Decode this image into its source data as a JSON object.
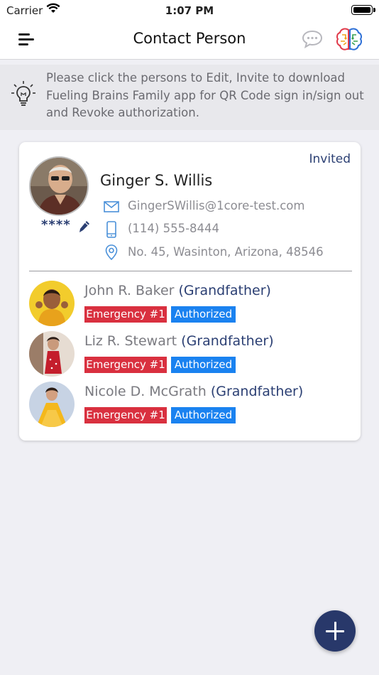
{
  "status_bar": {
    "carrier": "Carrier",
    "time": "1:07 PM"
  },
  "header": {
    "title": "Contact Person",
    "icons": [
      "menu-icon",
      "chat-icon",
      "brain-logo-icon"
    ]
  },
  "info_banner": {
    "icon": "lightbulb-icon",
    "text": "Please click the persons to Edit, Invite to download Fueling Brains Family app for QR Code sign in/sign out and Revoke authorization."
  },
  "contact": {
    "status": "Invited",
    "name": "Ginger S. Willis",
    "pin": "****",
    "email": "GingerSWillis@1core-test.com",
    "phone": "(114) 555-8444",
    "address": "No. 45, Wasinton, Arizona, 48546",
    "children": [
      {
        "name": "John R. Baker",
        "relation": "(Grandfather)",
        "emergency": "Emergency #1",
        "authorization": "Authorized"
      },
      {
        "name": "Liz R. Stewart",
        "relation": "(Grandfather)",
        "emergency": "Emergency #1",
        "authorization": "Authorized"
      },
      {
        "name": "Nicole D. McGrath",
        "relation": "(Grandfather)",
        "emergency": "Emergency #1",
        "authorization": "Authorized"
      }
    ]
  },
  "colors": {
    "accent": "#2b3f73",
    "emergency": "#d9303f",
    "authorized": "#1a82f0",
    "fab": "#28386a"
  }
}
